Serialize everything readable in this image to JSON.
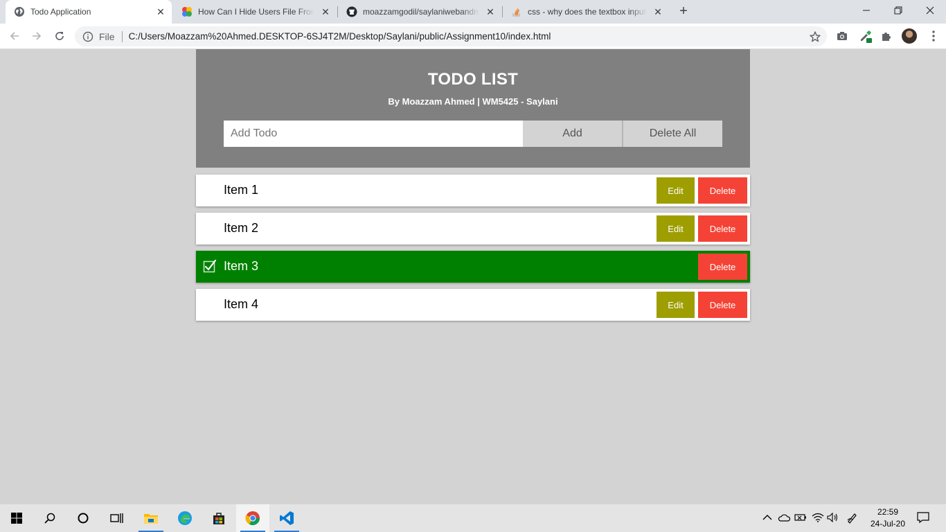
{
  "browser": {
    "tabs": [
      {
        "title": "Todo Application",
        "icon": "globe-icon",
        "active": true
      },
      {
        "title": "How Can I Hide Users File From C",
        "icon": "multicolor-dots-icon",
        "active": false
      },
      {
        "title": "moazzamgodil/saylaniwebandmo",
        "icon": "github-icon",
        "active": false
      },
      {
        "title": "css - why does the textbox input",
        "icon": "stackoverflow-icon",
        "active": false
      }
    ],
    "close_glyph": "✕",
    "new_tab_glyph": "+",
    "window_controls": {
      "minimize": "—",
      "restore": "❐",
      "close": "✕"
    },
    "address": {
      "scheme_label": "File",
      "url": "C:/Users/Moazzam%20Ahmed.DESKTOP-6SJ4T2M/Desktop/Saylani/public/Assignment10/index.html"
    }
  },
  "app": {
    "title": "TODO LIST",
    "subtitle": "By Moazzam Ahmed | WM5425 - Saylani",
    "input_placeholder": "Add Todo",
    "input_value": "",
    "add_label": "Add",
    "delete_all_label": "Delete All",
    "items": [
      {
        "label": "Item 1",
        "completed": false,
        "edit_label": "Edit",
        "delete_label": "Delete"
      },
      {
        "label": "Item 2",
        "completed": false,
        "edit_label": "Edit",
        "delete_label": "Delete"
      },
      {
        "label": "Item 3",
        "completed": true,
        "delete_label": "Delete"
      },
      {
        "label": "Item 4",
        "completed": false,
        "edit_label": "Edit",
        "delete_label": "Delete"
      }
    ],
    "colors": {
      "page_bg": "#d3d3d3",
      "header_bg": "#808080",
      "edit_bg": "#9e9e00",
      "delete_bg": "#f44336",
      "completed_bg": "#008000"
    }
  },
  "taskbar": {
    "apps": [
      "windows-start-icon",
      "search-icon",
      "cortana-icon",
      "task-view-icon",
      "file-explorer-icon",
      "edge-icon",
      "store-icon",
      "chrome-icon",
      "vscode-icon"
    ],
    "clock": {
      "time": "22:59",
      "date": "24-Jul-20"
    }
  }
}
